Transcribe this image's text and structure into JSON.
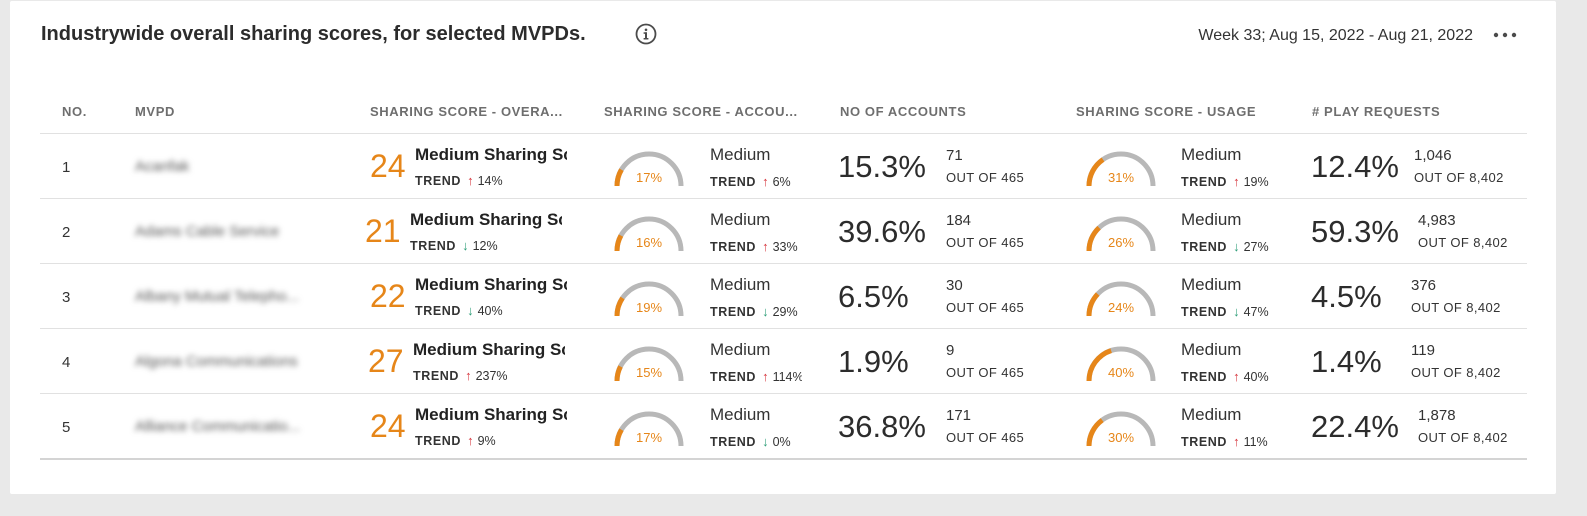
{
  "header": {
    "title": "Industrywide overall sharing scores, for selected MVPDs.",
    "date_range": "Week 33; Aug 15, 2022 - Aug 21, 2022",
    "info_icon": "info-circle-icon",
    "more_icon": "more-horizontal-icon"
  },
  "columns": [
    "NO.",
    "MVPD",
    "SHARING SCORE - OVERA...",
    "SHARING SCORE - ACCOU...",
    "NO OF ACCOUNTS",
    "SHARING SCORE - USAGE",
    "# PLAY REQUESTS"
  ],
  "trend_label": "TREND",
  "colors": {
    "accent_orange": "#e68619",
    "trend_up": "#d7373f",
    "trend_down": "#2d9d78",
    "gauge_track": "#b8b8b8"
  },
  "rows": [
    {
      "no": "1",
      "mvpd": "Acanfak",
      "overall": {
        "score": "24",
        "label": "Medium Sharing Score",
        "trend_dir": "up",
        "trend_arrow": "↑",
        "trend": "14%"
      },
      "account": {
        "pct": "17%",
        "level": 0.17,
        "label": "Medium",
        "trend_dir": "up",
        "trend_arrow": "↑",
        "trend": "6%"
      },
      "accounts": {
        "pct": "15.3%",
        "count": "71",
        "outof": "OUT OF 465"
      },
      "usage": {
        "pct": "31%",
        "level": 0.31,
        "label": "Medium",
        "trend_dir": "up",
        "trend_arrow": "↑",
        "trend": "19%"
      },
      "plays": {
        "pct": "12.4%",
        "count": "1,046",
        "outof": "OUT OF 8,402"
      }
    },
    {
      "no": "2",
      "mvpd": "Adams Cable Service",
      "overall": {
        "score": "21",
        "label": "Medium Sharing Score",
        "trend_dir": "down",
        "trend_arrow": "↓",
        "trend": "12%"
      },
      "account": {
        "pct": "16%",
        "level": 0.16,
        "label": "Medium",
        "trend_dir": "up",
        "trend_arrow": "↑",
        "trend": "33%"
      },
      "accounts": {
        "pct": "39.6%",
        "count": "184",
        "outof": "OUT OF 465"
      },
      "usage": {
        "pct": "26%",
        "level": 0.26,
        "label": "Medium",
        "trend_dir": "down",
        "trend_arrow": "↓",
        "trend": "27%"
      },
      "plays": {
        "pct": "59.3%",
        "count": "4,983",
        "outof": "OUT OF 8,402"
      }
    },
    {
      "no": "3",
      "mvpd": "Albany Mutual Telepho...",
      "overall": {
        "score": "22",
        "label": "Medium Sharing Score",
        "trend_dir": "down",
        "trend_arrow": "↓",
        "trend": "40%"
      },
      "account": {
        "pct": "19%",
        "level": 0.19,
        "label": "Medium",
        "trend_dir": "down",
        "trend_arrow": "↓",
        "trend": "29%"
      },
      "accounts": {
        "pct": "6.5%",
        "count": "30",
        "outof": "OUT OF 465"
      },
      "usage": {
        "pct": "24%",
        "level": 0.24,
        "label": "Medium",
        "trend_dir": "down",
        "trend_arrow": "↓",
        "trend": "47%"
      },
      "plays": {
        "pct": "4.5%",
        "count": "376",
        "outof": "OUT OF 8,402"
      }
    },
    {
      "no": "4",
      "mvpd": "Algona Communications",
      "overall": {
        "score": "27",
        "label": "Medium Sharing Score",
        "trend_dir": "up",
        "trend_arrow": "↑",
        "trend": "237%"
      },
      "account": {
        "pct": "15%",
        "level": 0.15,
        "label": "Medium",
        "trend_dir": "up",
        "trend_arrow": "↑",
        "trend": "114%"
      },
      "accounts": {
        "pct": "1.9%",
        "count": "9",
        "outof": "OUT OF 465"
      },
      "usage": {
        "pct": "40%",
        "level": 0.4,
        "label": "Medium",
        "trend_dir": "up",
        "trend_arrow": "↑",
        "trend": "40%"
      },
      "plays": {
        "pct": "1.4%",
        "count": "119",
        "outof": "OUT OF 8,402"
      }
    },
    {
      "no": "5",
      "mvpd": "Alliance Communicatio...",
      "overall": {
        "score": "24",
        "label": "Medium Sharing Score",
        "trend_dir": "up",
        "trend_arrow": "↑",
        "trend": "9%"
      },
      "account": {
        "pct": "17%",
        "level": 0.17,
        "label": "Medium",
        "trend_dir": "down",
        "trend_arrow": "↓",
        "trend": "0%"
      },
      "accounts": {
        "pct": "36.8%",
        "count": "171",
        "outof": "OUT OF 465"
      },
      "usage": {
        "pct": "30%",
        "level": 0.3,
        "label": "Medium",
        "trend_dir": "up",
        "trend_arrow": "↑",
        "trend": "11%"
      },
      "plays": {
        "pct": "22.4%",
        "count": "1,878",
        "outof": "OUT OF 8,402"
      }
    }
  ]
}
